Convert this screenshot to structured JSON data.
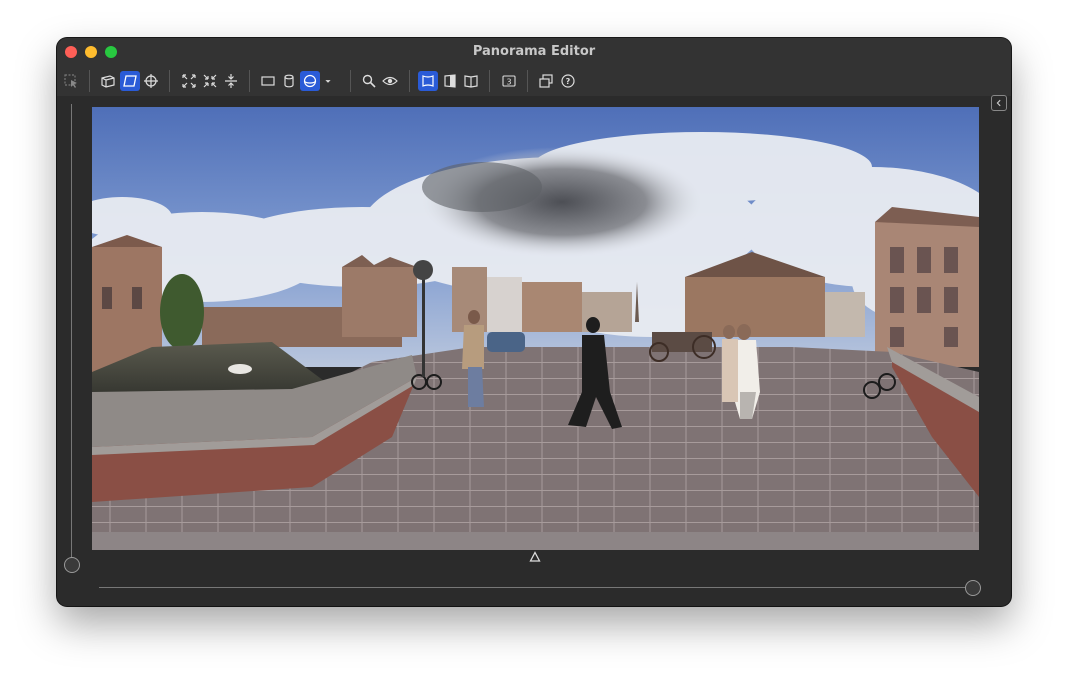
{
  "window": {
    "title": "Panorama Editor"
  },
  "toolbar": {
    "buttons": [
      {
        "name": "select-tool",
        "icon": "cursor-select-icon",
        "active": false
      },
      {
        "name": "view-cube",
        "icon": "cube-view-icon",
        "active": false
      },
      {
        "name": "view-plane",
        "icon": "plane-view-icon",
        "active": true
      },
      {
        "name": "target",
        "icon": "crosshair-icon",
        "active": false
      },
      {
        "name": "expand",
        "icon": "expand-icon",
        "active": false
      },
      {
        "name": "shrink",
        "icon": "shrink-icon",
        "active": false
      },
      {
        "name": "flip-vertical",
        "icon": "flip-vertical-icon",
        "active": false
      },
      {
        "name": "rectangle",
        "icon": "rectangle-icon",
        "active": false
      },
      {
        "name": "cylinder",
        "icon": "cylinder-icon",
        "active": false
      },
      {
        "name": "sphere",
        "icon": "sphere-icon",
        "active": true
      },
      {
        "name": "dropdown",
        "icon": "dropdown-arrow-icon",
        "active": false
      },
      {
        "name": "zoom",
        "icon": "magnifier-icon",
        "active": false
      },
      {
        "name": "preview",
        "icon": "eye-icon",
        "active": false
      },
      {
        "name": "warp-front",
        "icon": "warp-front-icon",
        "active": true
      },
      {
        "name": "warp-half",
        "icon": "warp-half-icon",
        "active": false
      },
      {
        "name": "warp-book",
        "icon": "warp-book-icon",
        "active": false
      },
      {
        "name": "three-d",
        "icon": "number-3-icon",
        "label": "3",
        "active": false
      },
      {
        "name": "layers",
        "icon": "layers-icon",
        "active": false
      },
      {
        "name": "help",
        "icon": "help-icon",
        "label": "?",
        "active": false
      }
    ]
  },
  "colors": {
    "accent": "#2a5bd7",
    "window_bg": "#2b2b2b",
    "toolbar_bg": "#333333"
  },
  "sliders": {
    "vertical_value": 0.0,
    "horizontal_value": 1.0
  }
}
